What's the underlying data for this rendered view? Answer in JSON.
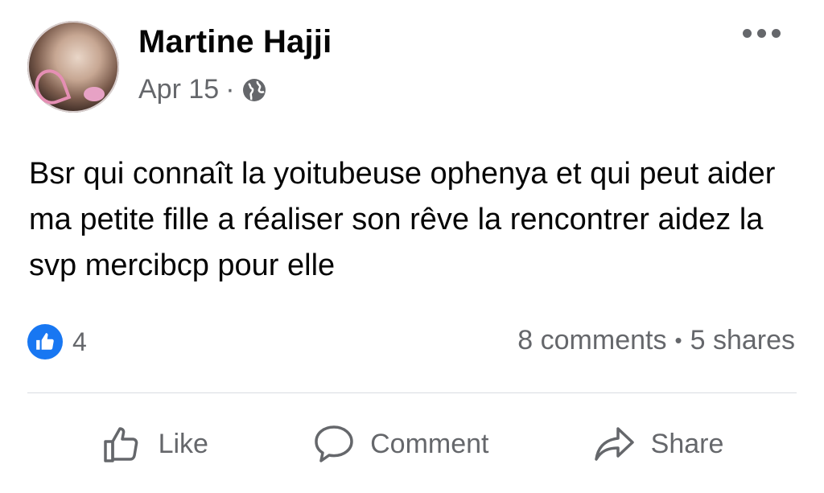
{
  "post": {
    "author": "Martine Hajji",
    "date": "Apr 15",
    "separator": "·",
    "privacy_icon": "globe-icon",
    "text": "Bsr qui connaît la yoitubeuse ophenya et qui peut aider ma petite fille a réaliser son rêve la rencontrer aidez la svp mercibcp pour elle"
  },
  "engagement": {
    "reaction_icon": "like-icon",
    "reaction_count": "4",
    "comments": "8 comments",
    "dot": "•",
    "shares": "5 shares"
  },
  "actions": {
    "like_label": "Like",
    "comment_label": "Comment",
    "share_label": "Share"
  },
  "colors": {
    "accent": "#1877f2",
    "secondary_text": "#65676b",
    "divider": "#dadde1"
  }
}
